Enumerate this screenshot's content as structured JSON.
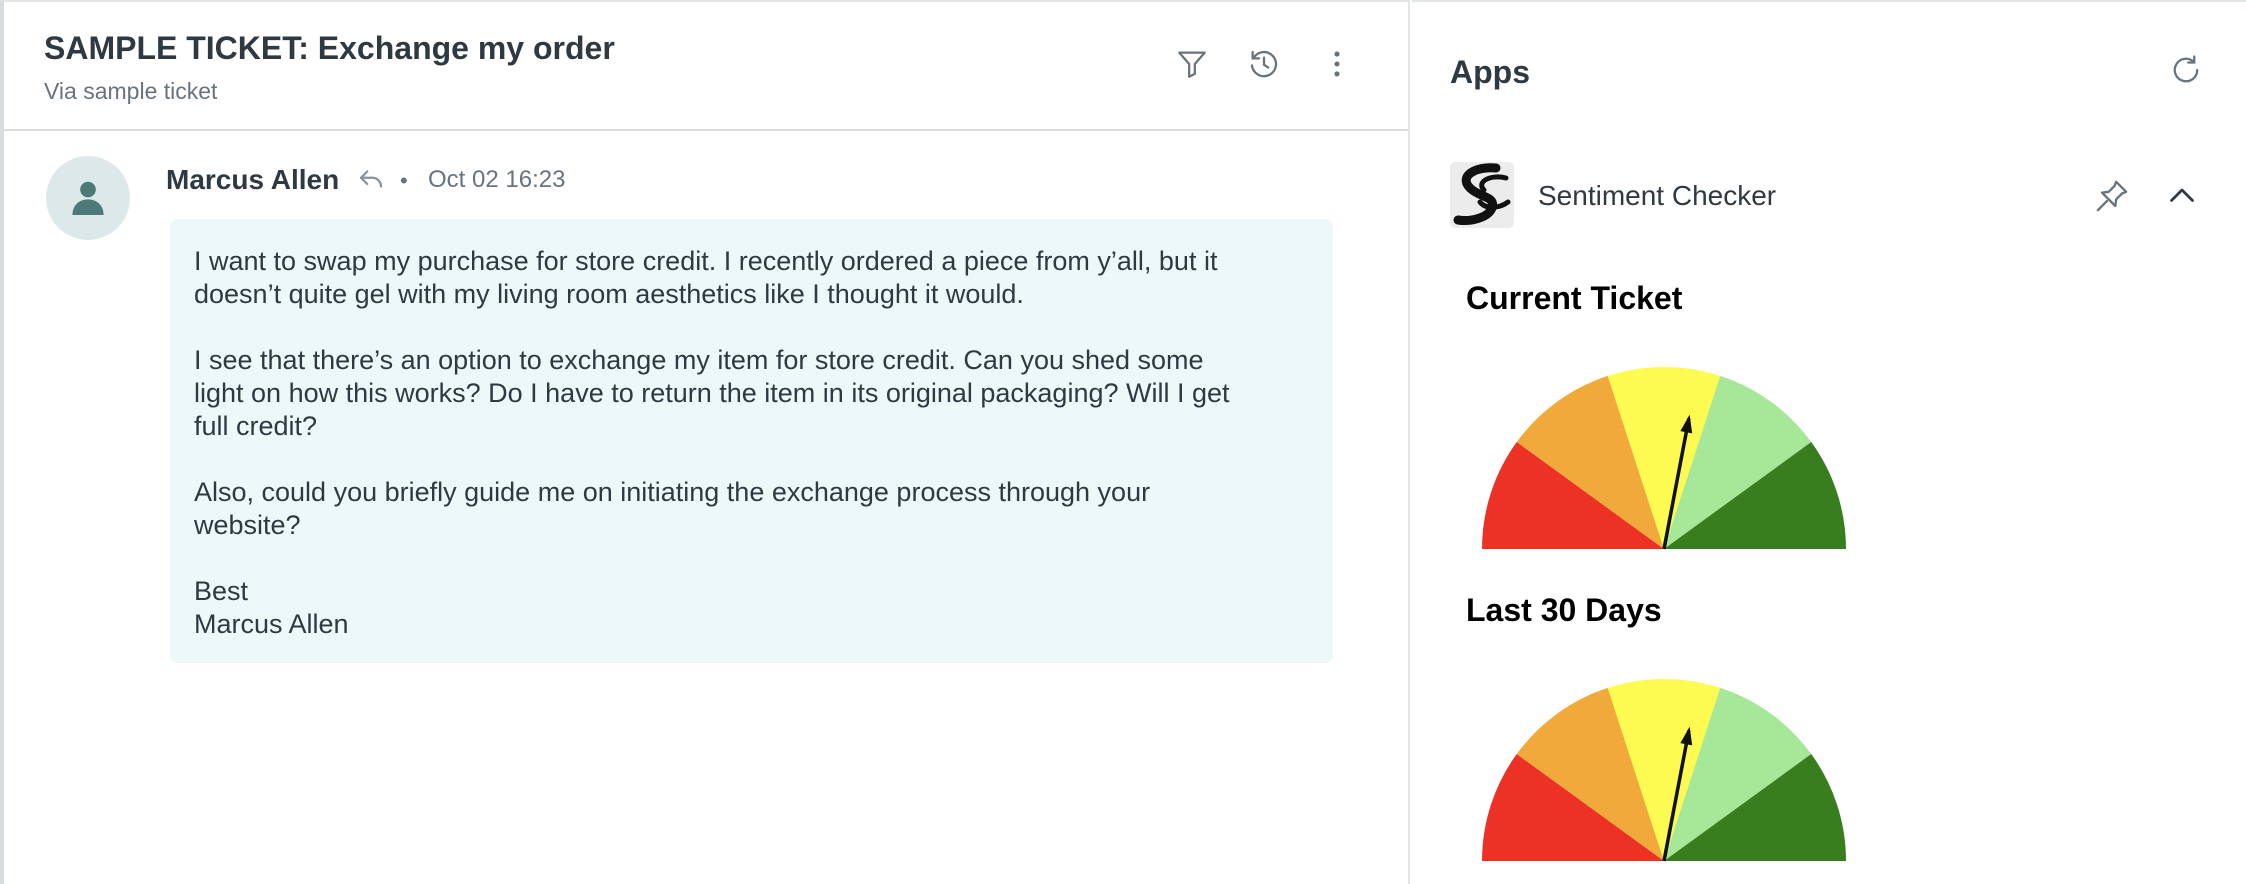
{
  "ticket": {
    "title": "SAMPLE TICKET: Exchange my order",
    "subtitle": "Via sample ticket",
    "header_icons": [
      "filter-icon",
      "history-icon",
      "more-vertical-icon"
    ]
  },
  "message": {
    "author": "Marcus Allen",
    "timestamp": "Oct 02 16:23",
    "separator": "•",
    "paragraphs": [
      [
        "I want to swap my purchase for store credit. I recently ordered a piece from y’all, but it",
        "doesn’t quite gel with my living room aesthetics like I thought it would."
      ],
      [
        "I see that there’s an option to exchange my item for store credit. Can you shed some",
        "light on how this works? Do I have to return the item in its original packaging? Will I get",
        "full credit?"
      ],
      [
        "Also, could you briefly guide me on initiating the exchange process through your",
        "website?"
      ],
      [
        "Best",
        "Marcus Allen"
      ]
    ]
  },
  "apps": {
    "title": "Apps",
    "app_name": "Sentiment Checker",
    "gauges": [
      {
        "title": "Current Ticket",
        "value": 0.56
      },
      {
        "title": "Last 30 Days",
        "value": 0.56
      }
    ],
    "segment_colors": [
      "#ec3225",
      "#f2a93b",
      "#fdfb51",
      "#a6e897",
      "#387d1e"
    ]
  }
}
